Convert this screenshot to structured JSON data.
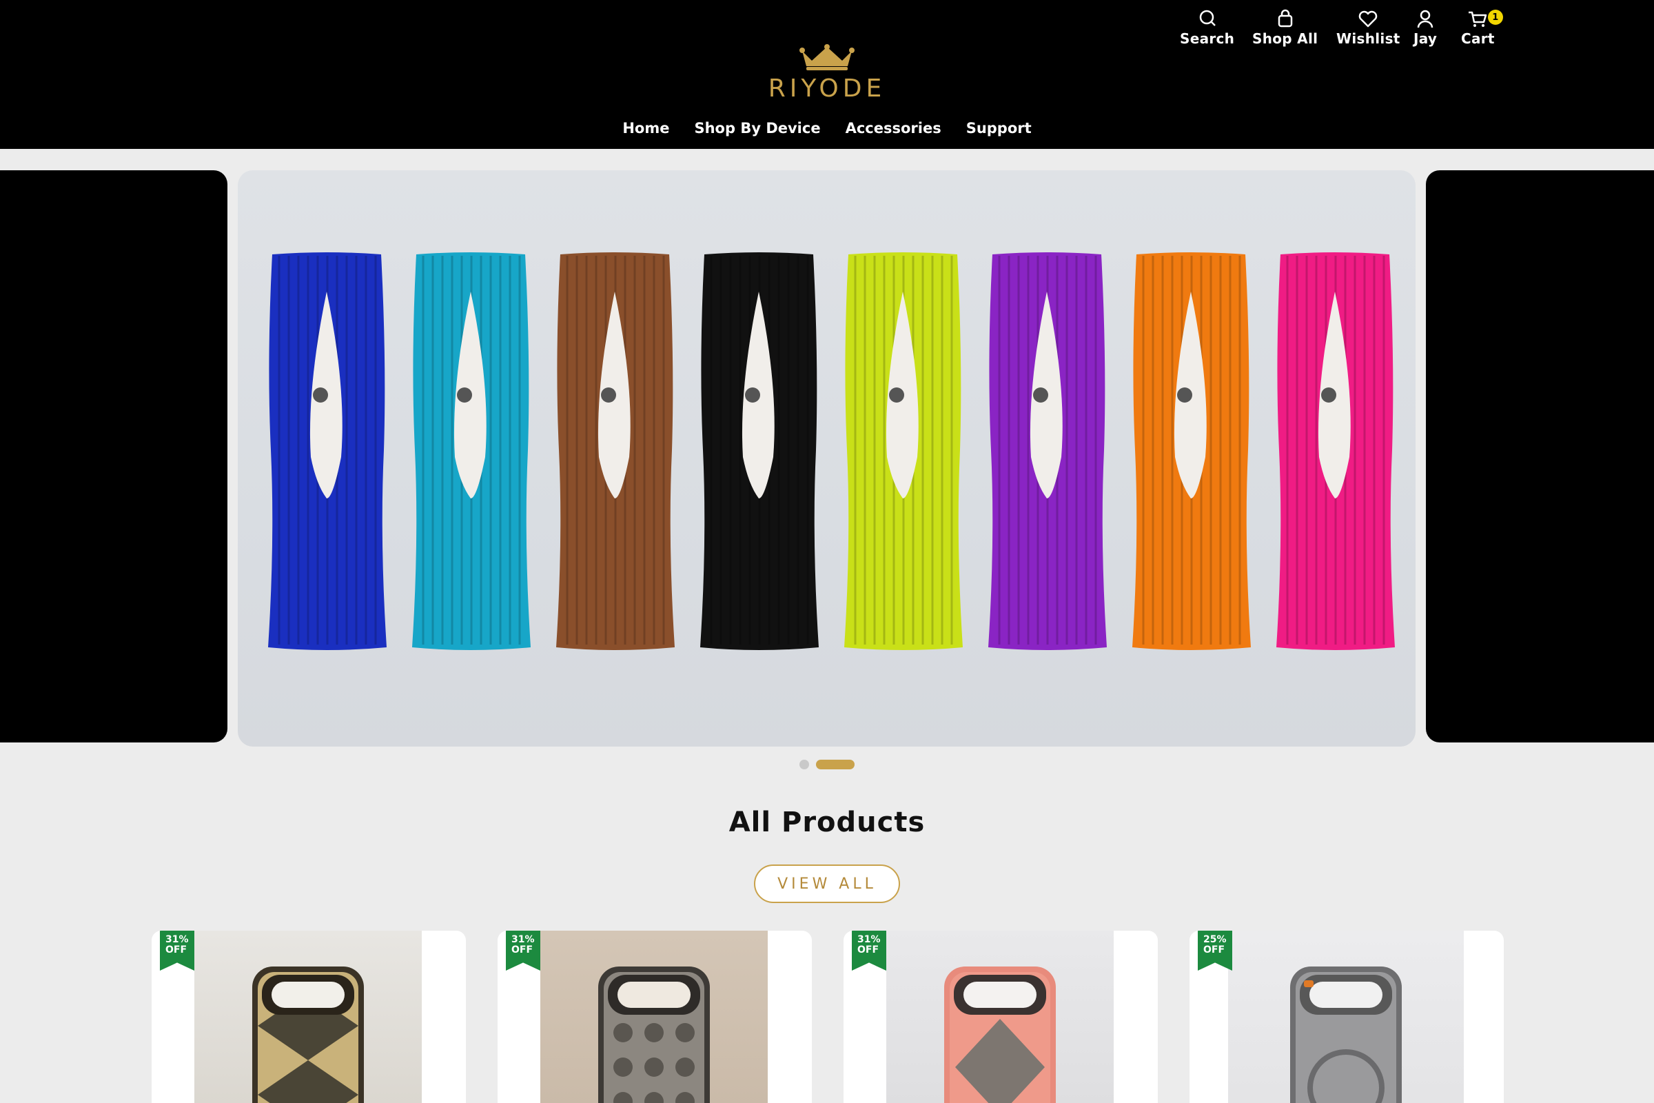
{
  "header": {
    "brand": "RIYODE",
    "utility": {
      "search": "Search",
      "shop_all": "Shop All",
      "wishlist": "Wishlist",
      "account": "Jay",
      "cart": "Cart",
      "cart_count": "1"
    },
    "nav": [
      "Home",
      "Shop By Device",
      "Accessories",
      "Support"
    ]
  },
  "carousel": {
    "slide_count": 2,
    "active_index": 1,
    "sock_colors": [
      "#1a2fc0",
      "#17a6c8",
      "#8a4f2b",
      "#111111",
      "#c9e018",
      "#8a24c4",
      "#f07a10",
      "#f01c84"
    ]
  },
  "products_section": {
    "title": "All Products",
    "view_all": "VIEW ALL",
    "products": [
      {
        "badge_line1": "31%",
        "badge_line2": "OFF",
        "image": "gold-monogram-phone-case"
      },
      {
        "badge_line1": "31%",
        "badge_line2": "OFF",
        "image": "grey-monogram-phone-case"
      },
      {
        "badge_line1": "31%",
        "badge_line2": "OFF",
        "image": "pink-monogram-phone-case"
      },
      {
        "badge_line1": "25%",
        "badge_line2": "OFF",
        "image": "clear-grey-magsafe-phone-case"
      }
    ]
  },
  "colors": {
    "header_bg": "#000000",
    "accent_gold": "#c9a24b",
    "badge_green": "#1c8a3f",
    "page_bg": "#ececec"
  }
}
